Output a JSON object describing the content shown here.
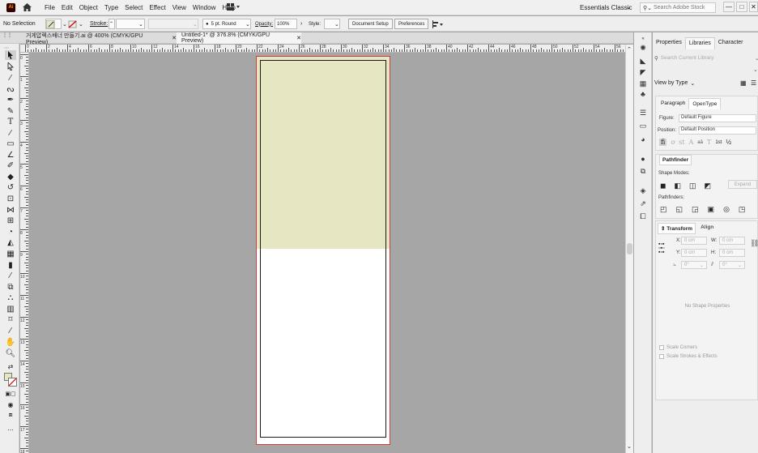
{
  "menubar": {
    "logo": "Ai",
    "items": [
      "File",
      "Edit",
      "Object",
      "Type",
      "Select",
      "Effect",
      "View",
      "Window",
      "Help"
    ],
    "workspace": "Essentials Classic",
    "search_placeholder": "Search Adobe Stock",
    "window_controls": [
      "—",
      "□",
      "✕"
    ]
  },
  "controlbar": {
    "selection_label": "No Selection",
    "stroke_label": "Stroke:",
    "brush_label": "5 pt. Round",
    "opacity_label": "Opacity:",
    "opacity_value": "100%",
    "style_label": "Style:",
    "document_setup": "Document Setup",
    "preferences": "Preferences"
  },
  "tabs": [
    {
      "title": "거게압렉스배너 만들기.ai @ 400% (CMYK/GPU Preview)",
      "close": "✕",
      "active": false
    },
    {
      "title": "Untitled-1* @ 376.8% (CMYK/GPU Preview)",
      "close": "✕",
      "active": true
    }
  ],
  "ruler_top": [
    "0",
    "2",
    "4",
    "6",
    "8",
    "10",
    "12",
    "14",
    "16",
    "18",
    "20",
    "22",
    "24",
    "26",
    "28",
    "30",
    "32",
    "34",
    "36",
    "38",
    "40",
    "42",
    "44",
    "46",
    "48",
    "50",
    "52",
    "54",
    "56",
    "58"
  ],
  "ruler_left": [
    "0",
    "1",
    "2",
    "3",
    "4",
    "5",
    "6",
    "7",
    "8",
    "9",
    "10",
    "11",
    "12",
    "13",
    "14",
    "15",
    "16",
    "17",
    "18"
  ],
  "panels": {
    "top_tabs": [
      "Properties",
      "Libraries",
      "Character"
    ],
    "active_top_tab": "Libraries",
    "library_search": "Search Current Library",
    "view_by": "View by Type",
    "text_tabs": [
      "Paragraph",
      "OpenType"
    ],
    "figure_label": "Figure:",
    "figure_value": "Default Figure",
    "position_label": "Position:",
    "position_value": "Default Position",
    "opentype_glyphs": [
      "fi",
      "ơ",
      "st",
      "A",
      "aā",
      "T",
      "1st",
      "½"
    ],
    "pathfinder_title": "Pathfinder",
    "shape_modes": "Shape Modes:",
    "expand": "Expand",
    "pathfinders": "Pathfinders:",
    "transform_tabs": [
      "Transform",
      "Align"
    ],
    "x_label": "X:",
    "x_value": "0 cm",
    "y_label": "Y:",
    "y_value": "0 cm",
    "w_label": "W:",
    "w_value": "0 cm",
    "h_label": "H:",
    "h_value": "0 cm",
    "angle_value": "0°",
    "shear_value": "0°",
    "no_shape": "No Shape Properties",
    "scale_corners": "Scale Corners",
    "scale_strokes": "Scale Strokes & Effects"
  },
  "colors": {
    "canvas": "#a6a6a6",
    "artboard_fill": "#e7e6c3",
    "bleed": "#d23c3c"
  }
}
